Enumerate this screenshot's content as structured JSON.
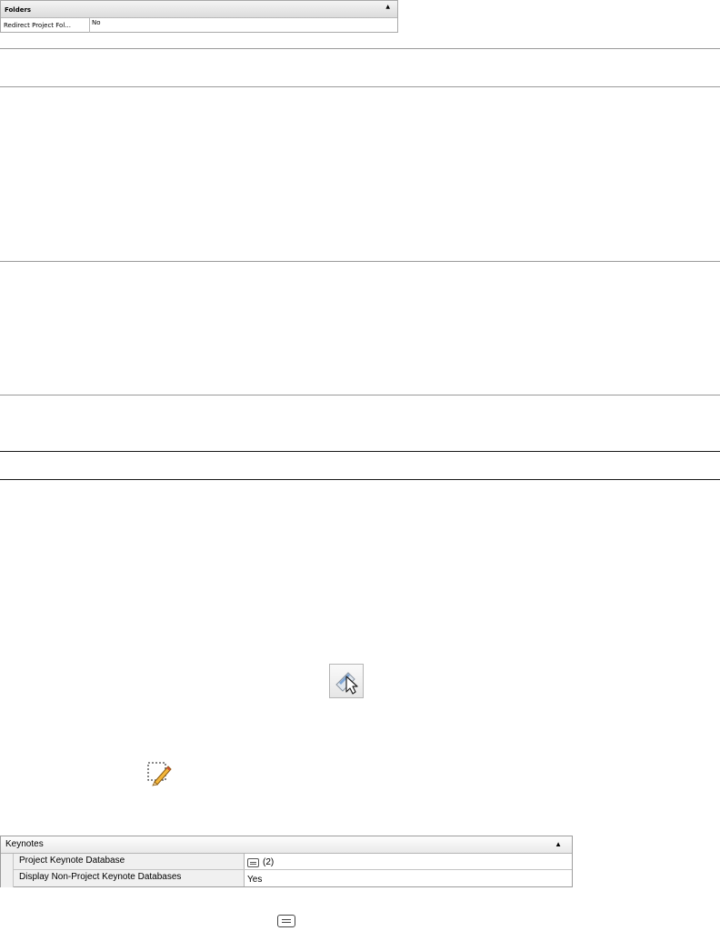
{
  "folders_panel": {
    "title": "Folders",
    "caret": "▲",
    "rows": [
      {
        "label": "Redirect Project Fol...",
        "value": "No"
      }
    ]
  },
  "icons": {
    "select_tool": "select-cursor-icon",
    "edit_tool": "pencil-edit-icon",
    "database": "database-list-icon"
  },
  "keynotes_panel": {
    "title": "Keynotes",
    "caret": "▲",
    "rows": [
      {
        "label": "Project Keynote Database",
        "value": "(2)",
        "icon": "database-list-icon"
      },
      {
        "label": "Display Non-Project Keynote Databases",
        "value": "Yes"
      }
    ]
  }
}
